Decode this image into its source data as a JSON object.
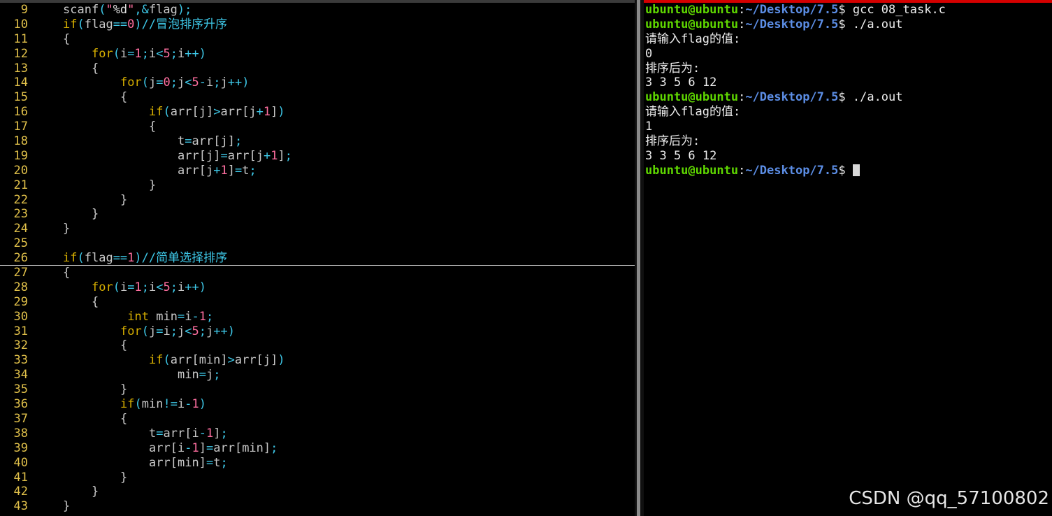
{
  "editor": {
    "lines": [
      {
        "n": "9",
        "t": "    scanf(\"%d\",&flag);"
      },
      {
        "n": "10",
        "t": "    if(flag==0)//冒泡排序升序"
      },
      {
        "n": "11",
        "t": "    {"
      },
      {
        "n": "12",
        "t": "        for(i=1;i<5;i++)"
      },
      {
        "n": "13",
        "t": "        {"
      },
      {
        "n": "14",
        "t": "            for(j=0;j<5-i;j++)"
      },
      {
        "n": "15",
        "t": "            {"
      },
      {
        "n": "16",
        "t": "                if(arr[j]>arr[j+1])"
      },
      {
        "n": "17",
        "t": "                {"
      },
      {
        "n": "18",
        "t": "                    t=arr[j];"
      },
      {
        "n": "19",
        "t": "                    arr[j]=arr[j+1];"
      },
      {
        "n": "20",
        "t": "                    arr[j+1]=t;"
      },
      {
        "n": "21",
        "t": "                }"
      },
      {
        "n": "22",
        "t": "            }"
      },
      {
        "n": "23",
        "t": "        }"
      },
      {
        "n": "24",
        "t": "    }"
      },
      {
        "n": "25",
        "t": ""
      },
      {
        "n": "26",
        "t": "    if(flag==1)//简单选择排序"
      },
      {
        "n": "27",
        "t": "    {"
      },
      {
        "n": "28",
        "t": "        for(i=1;i<5;i++)"
      },
      {
        "n": "29",
        "t": "        {"
      },
      {
        "n": "30",
        "t": "             int min=i-1;"
      },
      {
        "n": "31",
        "t": "            for(j=i;j<5;j++)"
      },
      {
        "n": "32",
        "t": "            {"
      },
      {
        "n": "33",
        "t": "                if(arr[min]>arr[j])"
      },
      {
        "n": "34",
        "t": "                    min=j;"
      },
      {
        "n": "35",
        "t": "            }"
      },
      {
        "n": "36",
        "t": "            if(min!=i-1)"
      },
      {
        "n": "37",
        "t": "            {"
      },
      {
        "n": "38",
        "t": "                t=arr[i-1];"
      },
      {
        "n": "39",
        "t": "                arr[i-1]=arr[min];"
      },
      {
        "n": "40",
        "t": "                arr[min]=t;"
      },
      {
        "n": "41",
        "t": "            }"
      },
      {
        "n": "42",
        "t": "        }"
      },
      {
        "n": "43",
        "t": "    }"
      }
    ]
  },
  "terminal": {
    "prompt_user": "ubuntu@ubuntu",
    "prompt_path": "~/Desktop/7.5",
    "lines": [
      {
        "type": "prompt",
        "cmd": "gcc 08_task.c"
      },
      {
        "type": "prompt",
        "cmd": "./a.out"
      },
      {
        "type": "out",
        "text": "请输入flag的值:"
      },
      {
        "type": "out",
        "text": "0"
      },
      {
        "type": "out",
        "text": "排序后为:"
      },
      {
        "type": "out",
        "text": "3 3 5 6 12"
      },
      {
        "type": "prompt",
        "cmd": "./a.out"
      },
      {
        "type": "out",
        "text": "请输入flag的值:"
      },
      {
        "type": "out",
        "text": "1"
      },
      {
        "type": "out",
        "text": "排序后为:"
      },
      {
        "type": "out",
        "text": "3 3 5 6 12"
      },
      {
        "type": "prompt",
        "cmd": ""
      }
    ]
  },
  "watermark": "CSDN @qq_57100802",
  "colors": {
    "line_number": "#e0c04a",
    "keyword": "#d7af00",
    "number": "#ff6fa0",
    "string": "#ff6fa0",
    "comment": "#3ec8e8",
    "punct": "#3ec8e8",
    "prompt_user": "#5fd700",
    "prompt_path": "#5c8ee6"
  }
}
